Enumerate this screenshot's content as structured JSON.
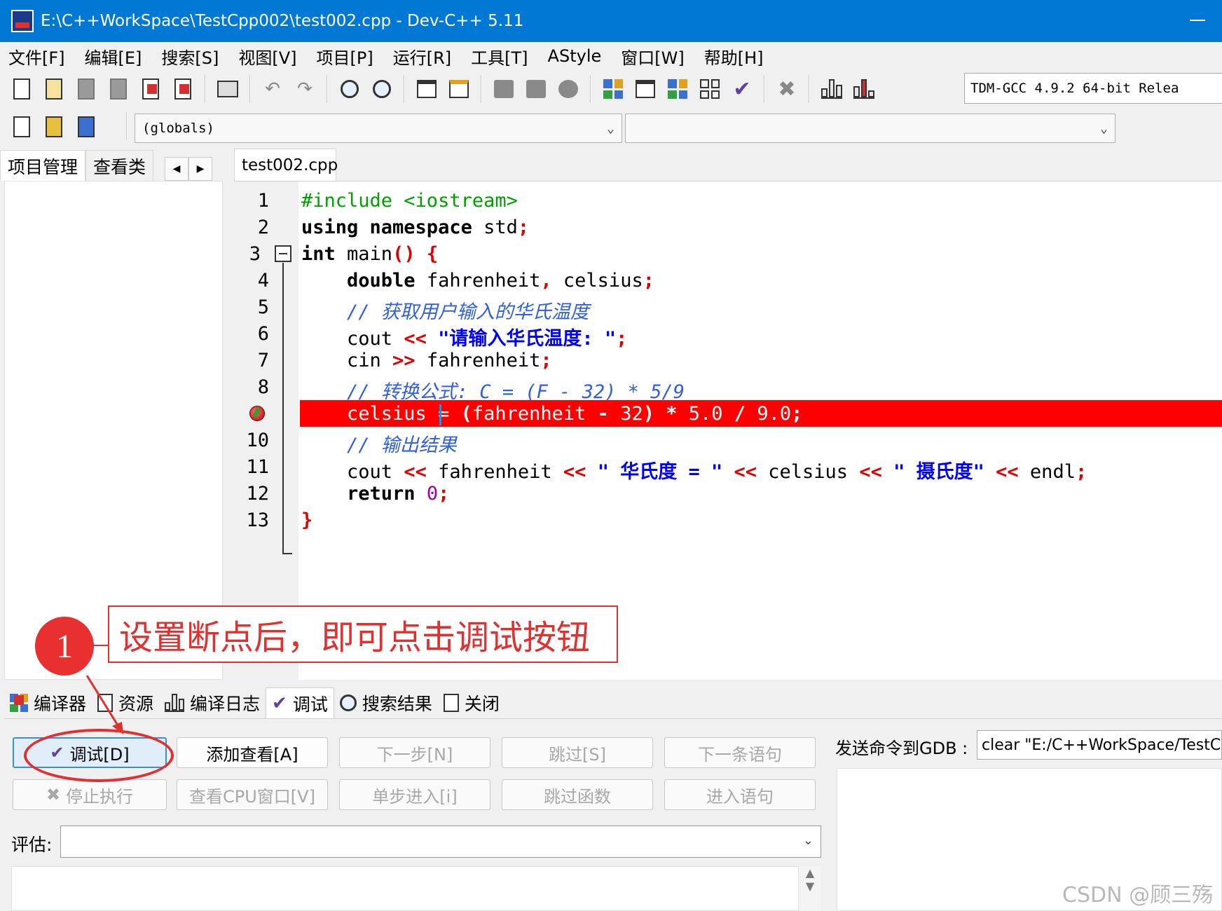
{
  "window": {
    "title": "E:\\C++WorkSpace\\TestCpp002\\test002.cpp - Dev-C++ 5.11",
    "app_icon": "dev-cpp-icon"
  },
  "menu": [
    "文件[F]",
    "编辑[E]",
    "搜索[S]",
    "视图[V]",
    "项目[P]",
    "运行[R]",
    "工具[T]",
    "AStyle",
    "窗口[W]",
    "帮助[H]"
  ],
  "toolbar": {
    "compiler_select": "TDM-GCC 4.9.2 64-bit Relea"
  },
  "combos": {
    "scope": "(globals)",
    "function": ""
  },
  "left_tabs": [
    "项目管理",
    "查看类"
  ],
  "editor": {
    "tab": "test002.cpp",
    "line_numbers": [
      "1",
      "2",
      "3",
      "4",
      "5",
      "6",
      "7",
      "8",
      "",
      "10",
      "11",
      "12",
      "13"
    ],
    "breakpoint_line": 9
  },
  "annotation": {
    "number": "1",
    "text": "设置断点后，即可点击调试按钮"
  },
  "bottom_tabs": [
    "编译器",
    "资源",
    "编译日志",
    "调试",
    "搜索结果",
    "关闭"
  ],
  "debug_buttons": {
    "debug": "调试[D]",
    "add_watch": "添加查看[A]",
    "next_step": "下一步[N]",
    "skip": "跳过[S]",
    "next_statement": "下一条语句",
    "stop": "停止执行",
    "cpu_window": "查看CPU窗口[V]",
    "step_into": "单步进入[i]",
    "skip_function": "跳过函数",
    "into_statement": "进入语句"
  },
  "gdb": {
    "label": "发送命令到GDB :",
    "command": "clear \"E:/C++WorkSpace/TestCpp"
  },
  "eval": {
    "label": "评估:",
    "value": ""
  },
  "watermark": "CSDN @顾三殇",
  "colors": {
    "titlebar": "#0078d4",
    "breakpoint": "#ff0000",
    "annotation": "#e03030"
  }
}
